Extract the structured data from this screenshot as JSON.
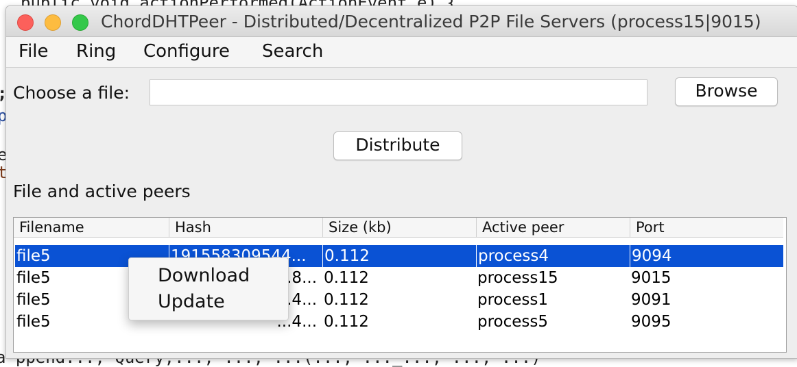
{
  "background_code": {
    "top_line": "public void actionPerformed(ActionEvent e) {",
    "left_fragments": [
      ";",
      "p",
      "e",
      "t"
    ],
    "bottom_line": "a ppend..., Query,..., ..., ...(..., ..._..., ..., ...)"
  },
  "window": {
    "title": "ChordDHTPeer - Distributed/Decentralized P2P File Servers (process15|9015)"
  },
  "menubar": {
    "items": [
      "File",
      "Ring",
      "Configure",
      "Search"
    ]
  },
  "form": {
    "choose_label": "Choose a file:",
    "file_value": "",
    "browse_label": "Browse",
    "distribute_label": "Distribute"
  },
  "section": {
    "title": "File and active peers"
  },
  "table": {
    "columns": [
      "Filename",
      "Hash",
      "Size (kb)",
      "Active peer",
      "Port"
    ],
    "rows": [
      {
        "filename": "file5",
        "hash": "191558309544...",
        "size": "0.112",
        "peer": "process4",
        "port": "9094",
        "selected": true
      },
      {
        "filename": "file5",
        "hash": "...8...",
        "size": "0.112",
        "peer": "process15",
        "port": "9015",
        "selected": false
      },
      {
        "filename": "file5",
        "hash": "...4...",
        "size": "0.112",
        "peer": "process1",
        "port": "9091",
        "selected": false
      },
      {
        "filename": "file5",
        "hash": "...4...",
        "size": "0.112",
        "peer": "process5",
        "port": "9095",
        "selected": false
      }
    ]
  },
  "context_menu": {
    "items": [
      "Download",
      "Update"
    ]
  }
}
